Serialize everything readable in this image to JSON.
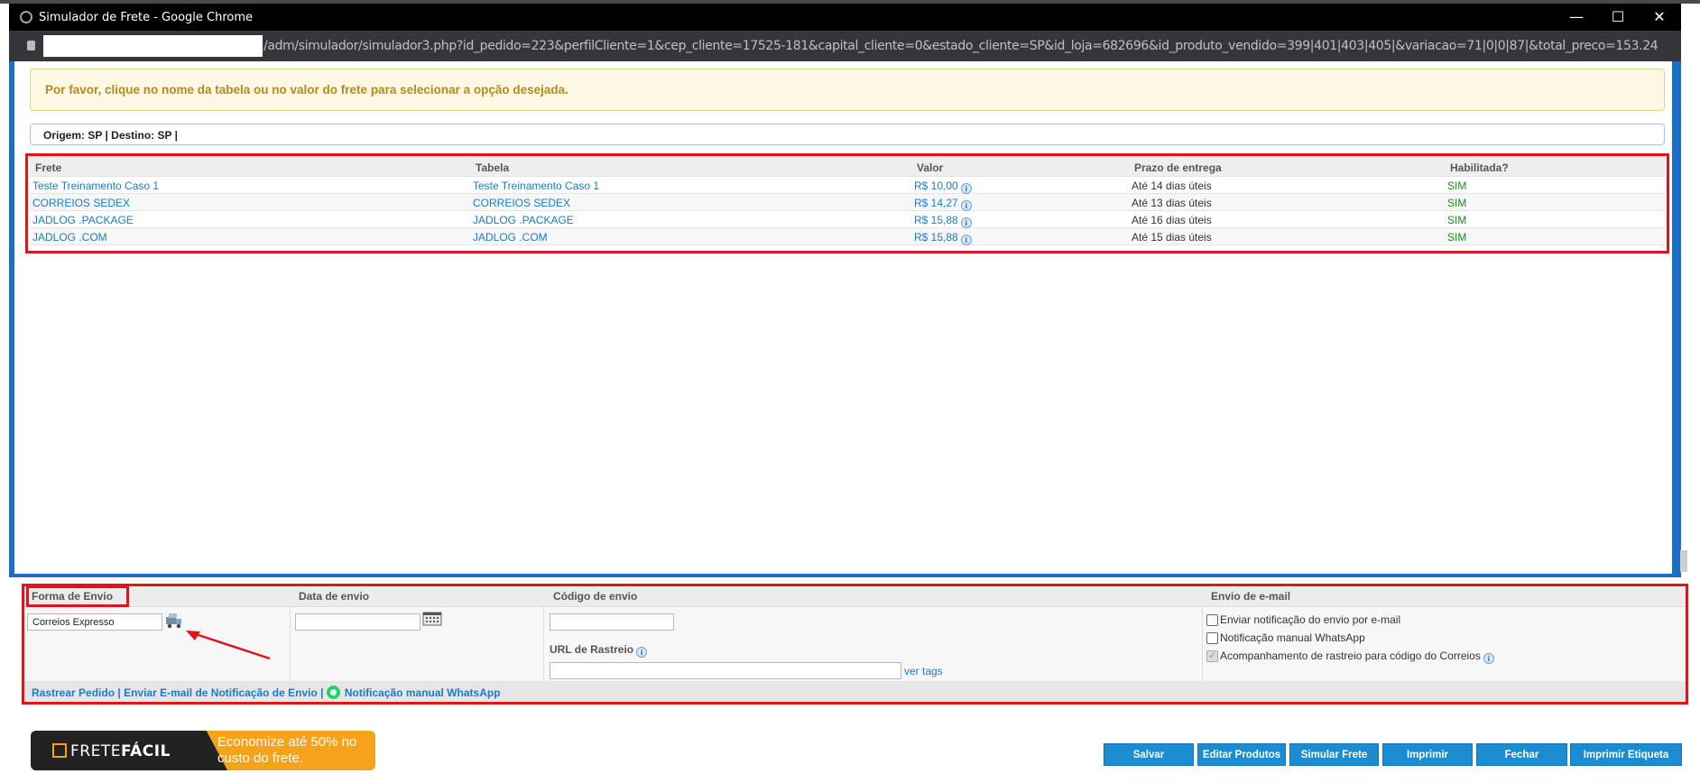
{
  "window": {
    "title": "Simulador de Frete - Google Chrome",
    "minimize": "—",
    "maximize": "☐",
    "close": "✕"
  },
  "url": "/adm/simulador/simulador3.php?id_pedido=223&perfilCliente=1&cep_cliente=17525-181&capital_cliente=0&estado_cliente=SP&id_loja=682696&id_produto_vendido=399|401|403|405|&variacao=71|0|0|87|&total_preco=153.24",
  "alert": "Por favor, clique no nome da tabela ou no valor do frete para selecionar a opção desejada.",
  "origin": "Origem: SP | Destino: SP |",
  "freight_table": {
    "headers": [
      "Frete",
      "Tabela",
      "Valor",
      "Prazo de entrega",
      "Habilitada?"
    ],
    "rows": [
      {
        "frete": "Teste Treinamento Caso 1",
        "tabela": "Teste Treinamento Caso 1",
        "valor": "R$ 10,00",
        "prazo": "Até 14 dias úteis",
        "habilitada": "SIM"
      },
      {
        "frete": "CORREIOS SEDEX",
        "tabela": "CORREIOS SEDEX",
        "valor": "R$ 14,27",
        "prazo": "Até 13 dias úteis",
        "habilitada": "SIM"
      },
      {
        "frete": "JADLOG .PACKAGE",
        "tabela": "JADLOG .PACKAGE",
        "valor": "R$ 15,88",
        "prazo": "Até 16 dias úteis",
        "habilitada": "SIM"
      },
      {
        "frete": "JADLOG .COM",
        "tabela": "JADLOG .COM",
        "valor": "R$ 15,88",
        "prazo": "Até 15 dias úteis",
        "habilitada": "SIM"
      }
    ],
    "info_icon": "i"
  },
  "shipping": {
    "headers": {
      "forma": "Forma de Envio",
      "data": "Data de envio",
      "codigo": "Código de envio",
      "email": "Envio de e-mail"
    },
    "forma_value": "Correios Expresso",
    "data_value": "",
    "codigo_value": "",
    "url_rastreio_label": "URL de Rastreio",
    "url_rastreio_value": "",
    "ver_tags": "ver tags",
    "checkboxes": [
      {
        "label": "Enviar notificação do envio por e-mail",
        "checked": false
      },
      {
        "label": "Notificação manual WhatsApp",
        "checked": false
      },
      {
        "label": "Acompanhamento de rastreio para código do Correios",
        "checked": true
      }
    ],
    "footer_links": {
      "rastrear": "Rastrear Pedido",
      "sep1": " | ",
      "email": "Enviar E-mail de Notificação de Envio",
      "sep2": " | ",
      "whatsapp": "Notificação manual WhatsApp"
    }
  },
  "banner": {
    "logo_light": "FRETE",
    "logo_bold": "FÁCIL",
    "promo": "Economize até 50% no custo do frete."
  },
  "buttons": {
    "salvar": "Salvar",
    "editar": "Editar Produtos",
    "simular": "Simular Frete",
    "imprimir": "Imprimir",
    "fechar": "Fechar",
    "etiqueta": "Imprimir Etiqueta"
  },
  "colors": {
    "link": "#1a7bc4",
    "button": "#1b8cd2",
    "highlight_border": "#e0141c",
    "enabled_green": "#1c8a1c",
    "alert_text": "#b38b1e"
  }
}
